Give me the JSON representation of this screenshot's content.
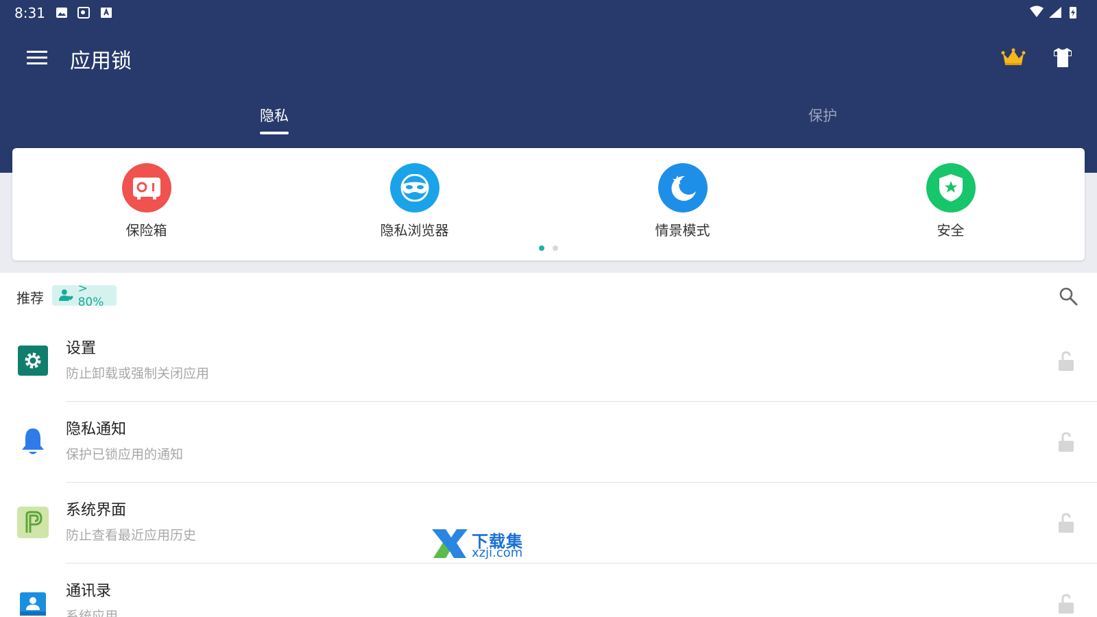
{
  "status_bar": {
    "time": "8:31"
  },
  "app_bar": {
    "title": "应用锁"
  },
  "tabs": [
    {
      "label": "隐私",
      "selected": true
    },
    {
      "label": "保护",
      "selected": false
    }
  ],
  "features": [
    {
      "label": "保险箱",
      "icon": "safe-box-icon",
      "color": "#f0524e"
    },
    {
      "label": "隐私浏览器",
      "icon": "mask-icon",
      "color": "#1aa3e8"
    },
    {
      "label": "情景模式",
      "icon": "moon-star-icon",
      "color": "#1e8fe8"
    },
    {
      "label": "安全",
      "icon": "shield-star-icon",
      "color": "#17c56a"
    }
  ],
  "pager": {
    "pages": 2,
    "current": 1
  },
  "recommend": {
    "label": "推荐",
    "badge": "> 80%"
  },
  "apps": [
    {
      "name": "设置",
      "desc": "防止卸载或强制关闭应用",
      "icon": "settings-gear-icon"
    },
    {
      "name": "隐私通知",
      "desc": "保护已锁应用的通知",
      "icon": "bell-icon"
    },
    {
      "name": "系统界面",
      "desc": "防止查看最近应用历史",
      "icon": "android-p-icon"
    },
    {
      "name": "通讯录",
      "desc": "系统应用",
      "icon": "contacts-icon"
    }
  ],
  "watermark": {
    "brand": "下载集",
    "site": "xzji.com"
  },
  "colors": {
    "primary": "#283a6b",
    "accent": "#1fb3a7",
    "background_band": "#ebecf1"
  }
}
